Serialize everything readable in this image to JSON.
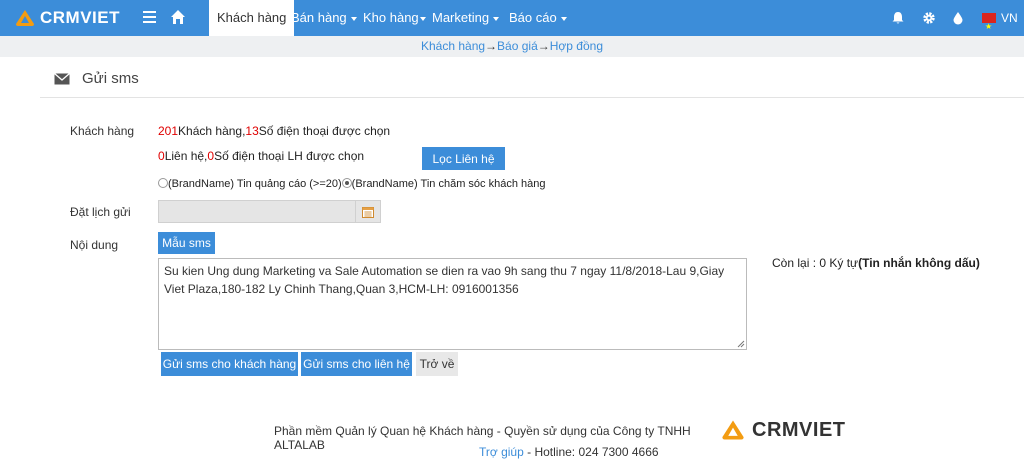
{
  "navbar": {
    "logo_text": "CRMVIET",
    "items": [
      {
        "label": "Khách hàng"
      },
      {
        "label": "Bán hàng"
      },
      {
        "label": "Kho hàng"
      },
      {
        "label": "Marketing"
      },
      {
        "label": "Báo cáo"
      }
    ],
    "language": "VN"
  },
  "breadcrumb": {
    "items": [
      "Khách hàng",
      "Báo giá",
      "Hợp đồng"
    ],
    "separator": "→"
  },
  "page": {
    "title": "Gửi sms"
  },
  "form": {
    "customer_label": "Khách hàng",
    "customer_count": "201",
    "customer_count_text": "Khách hàng,",
    "phone_count": "13",
    "phone_count_text": "Số điện thoại được chọn",
    "contact_count": "0",
    "contact_count_text": "Liên hệ,",
    "contact_phone_count": "0",
    "contact_phone_text": "Số điện thoại LH được chọn",
    "filter_contacts_button": "Lọc Liên hệ",
    "radio_ad_label": "(BrandName) Tin quảng cáo (>=20)",
    "radio_care_label": "(BrandName) Tin chăm sóc khách hàng",
    "schedule_label": "Đặt lịch gửi",
    "schedule_value": "",
    "content_label": "Nội dung",
    "template_button": "Mẫu sms",
    "content_value": "Su kien Ung dung Marketing va Sale Automation se dien ra vao 9h sang thu 7 ngay 11/8/2018-Lau 9,Giay Viet Plaza,180-182 Ly Chinh Thang,Quan 3,HCM-LH: 0916001356",
    "remaining_prefix": "Còn lại : 0 Ký tự",
    "remaining_note": "(Tin nhắn không dấu)",
    "send_customers_button": "Gửi sms cho khách hàng",
    "send_contacts_button": "Gửi sms cho liên hệ",
    "back_button": "Trở về"
  },
  "footer": {
    "line1": "Phần mềm Quản lý Quan hệ Khách hàng - Quyền sử dụng của Công ty TNHH ALTALAB",
    "help_link": "Trợ giúp",
    "hotline": " - Hotline: 024 7300 4666",
    "logo_text": "CRMVIET"
  },
  "colors": {
    "brand_blue": "#3c8dd9",
    "brand_orange": "#f39c12",
    "count_red": "#e00000"
  },
  "icons": {
    "logo": "crm-logo-icon",
    "menu": "hamburger-icon",
    "home": "home-icon",
    "bell": "bell-icon",
    "settings": "gear-icon",
    "drop": "drop-icon",
    "flag": "vietnam-flag-icon",
    "page": "envelope-icon",
    "calendar": "calendar-icon"
  }
}
